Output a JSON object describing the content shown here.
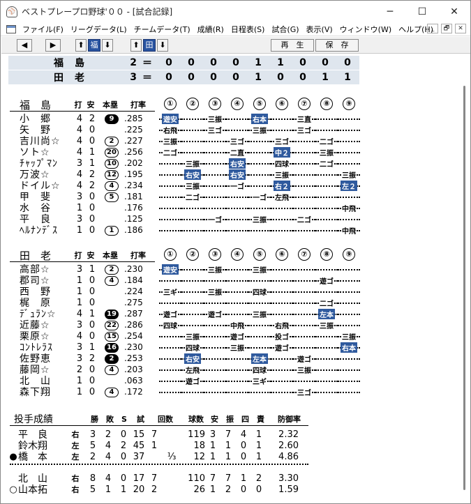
{
  "window": {
    "title": "ベストプレープロ野球'００ - [試合記録]",
    "minimize": "─",
    "maximize": "☐",
    "close": "✕"
  },
  "menu": [
    "ファイル(F)",
    "リーグデータ(L)",
    "チームデータ(T)",
    "成績(R)",
    "日程表(S)",
    "試合(G)",
    "表示(V)",
    "ウィンドウ(W)",
    "ヘルプ(H)"
  ],
  "mdi": [
    "_",
    "🗗",
    "✕"
  ],
  "toolbar": {
    "prev": "◀",
    "next": "▶",
    "up1": "⬆",
    "team_active": "福",
    "down1": "⬇",
    "up2": "⬆",
    "team2": "田",
    "down2": "⬇",
    "play": "再　生",
    "save": "保　存"
  },
  "scoreboard": [
    {
      "team": "福島",
      "total": "2",
      "eq": "＝",
      "innings": [
        "0",
        "0",
        "0",
        "0",
        "1",
        "1",
        "0",
        "0",
        "0"
      ]
    },
    {
      "team": "田老",
      "total": "3",
      "eq": "＝",
      "innings": [
        "0",
        "0",
        "0",
        "0",
        "1",
        "0",
        "0",
        "1",
        "1"
      ]
    }
  ],
  "batting_headers": {
    "ab": "打",
    "h": "安",
    "hr": "本塁",
    "avg": "打率"
  },
  "innings_labels": [
    "①",
    "②",
    "③",
    "④",
    "⑤",
    "⑥",
    "⑦",
    "⑧",
    "⑨"
  ],
  "team1": {
    "name": "福　島",
    "players": [
      {
        "name": "小　郷",
        "ab": "4",
        "h": "2",
        "hr": "9",
        "hr_filled": true,
        "avg": ".285",
        "res": [
          [
            "遊安",
            1
          ],
          [
            "",
            0
          ],
          [
            "三振",
            0
          ],
          [
            "",
            0
          ],
          [
            "右本",
            1
          ],
          [
            "",
            0
          ],
          [
            "三直",
            0
          ],
          [
            "",
            0
          ],
          [
            "",
            0
          ]
        ]
      },
      {
        "name": "矢　野",
        "ab": "4",
        "h": "0",
        "hr": "",
        "avg": ".225",
        "res": [
          [
            "右飛",
            0
          ],
          [
            "",
            0
          ],
          [
            "三ゴ",
            0
          ],
          [
            "",
            0
          ],
          [
            "三振",
            0
          ],
          [
            "",
            0
          ],
          [
            "三ゴ",
            0
          ],
          [
            "",
            0
          ],
          [
            "",
            0
          ]
        ]
      },
      {
        "name": "吉川尚☆",
        "ab": "4",
        "h": "0",
        "hr": "2",
        "avg": ".227",
        "res": [
          [
            "三振",
            0
          ],
          [
            "",
            0
          ],
          [
            "",
            0
          ],
          [
            "三ゴ",
            0
          ],
          [
            "",
            0
          ],
          [
            "三ゴ",
            0
          ],
          [
            "",
            0
          ],
          [
            "二ゴ",
            0
          ],
          [
            "",
            0
          ]
        ]
      },
      {
        "name": "ソト☆",
        "ab": "4",
        "h": "1",
        "hr": "20",
        "avg": ".256",
        "res": [
          [
            "二ゴ",
            0
          ],
          [
            "",
            0
          ],
          [
            "",
            0
          ],
          [
            "二直",
            0
          ],
          [
            "",
            0
          ],
          [
            "中２",
            1
          ],
          [
            "",
            0
          ],
          [
            "三振",
            0
          ],
          [
            "",
            0
          ]
        ]
      },
      {
        "name": "ﾁｬｯﾌﾟﾏﾝ",
        "ab": "3",
        "h": "1",
        "hr": "10",
        "avg": ".202",
        "res": [
          [
            "",
            0
          ],
          [
            "三振",
            0
          ],
          [
            "",
            0
          ],
          [
            "右安",
            1
          ],
          [
            "",
            0
          ],
          [
            "四球",
            0
          ],
          [
            "",
            0
          ],
          [
            "二ゴ",
            0
          ],
          [
            "",
            0
          ]
        ]
      },
      {
        "name": "万波☆",
        "ab": "4",
        "h": "2",
        "hr": "12",
        "avg": ".195",
        "res": [
          [
            "",
            0
          ],
          [
            "右安",
            1
          ],
          [
            "",
            0
          ],
          [
            "右安",
            1
          ],
          [
            "",
            0
          ],
          [
            "三振",
            0
          ],
          [
            "",
            0
          ],
          [
            "",
            0
          ],
          [
            "三振",
            0
          ]
        ]
      },
      {
        "name": "ドイル☆",
        "ab": "4",
        "h": "2",
        "hr": "4",
        "avg": ".234",
        "res": [
          [
            "",
            0
          ],
          [
            "三振",
            0
          ],
          [
            "",
            0
          ],
          [
            "一ゴ",
            0
          ],
          [
            "",
            0
          ],
          [
            "右２",
            1
          ],
          [
            "",
            0
          ],
          [
            "",
            0
          ],
          [
            "左２",
            1
          ]
        ]
      },
      {
        "name": "甲　斐",
        "ab": "3",
        "h": "0",
        "hr": "5",
        "avg": ".181",
        "res": [
          [
            "",
            0
          ],
          [
            "二ゴ",
            0
          ],
          [
            "",
            0
          ],
          [
            "",
            0
          ],
          [
            "一ゴ",
            0
          ],
          [
            "左飛",
            0
          ],
          [
            "",
            0
          ],
          [
            "",
            0
          ],
          [
            "",
            0
          ]
        ]
      },
      {
        "name": "水　谷",
        "ab": "1",
        "h": "0",
        "hr": "",
        "avg": ".176",
        "res": [
          [
            "",
            0
          ],
          [
            "",
            0
          ],
          [
            "",
            0
          ],
          [
            "",
            0
          ],
          [
            "",
            0
          ],
          [
            "",
            0
          ],
          [
            "",
            0
          ],
          [
            "",
            0
          ],
          [
            "中飛",
            0
          ]
        ]
      },
      {
        "name": "平　良",
        "ab": "3",
        "h": "0",
        "hr": "",
        "avg": ".125",
        "res": [
          [
            "",
            0
          ],
          [
            "",
            0
          ],
          [
            "一ゴ",
            0
          ],
          [
            "",
            0
          ],
          [
            "三振",
            0
          ],
          [
            "",
            0
          ],
          [
            "二ゴ",
            0
          ],
          [
            "",
            0
          ],
          [
            "",
            0
          ]
        ]
      },
      {
        "name": "ﾍﾙﾅﾝﾃﾞｽ",
        "ab": "1",
        "h": "0",
        "hr": "1",
        "avg": ".186",
        "res": [
          [
            "",
            0
          ],
          [
            "",
            0
          ],
          [
            "",
            0
          ],
          [
            "",
            0
          ],
          [
            "",
            0
          ],
          [
            "",
            0
          ],
          [
            "",
            0
          ],
          [
            "",
            0
          ],
          [
            "中飛",
            0
          ]
        ]
      }
    ]
  },
  "team2": {
    "name": "田　老",
    "players": [
      {
        "name": "高部☆",
        "ab": "3",
        "h": "1",
        "hr": "2",
        "avg": ".230",
        "res": [
          [
            "遊安",
            1
          ],
          [
            "",
            0
          ],
          [
            "三振",
            0
          ],
          [
            "",
            0
          ],
          [
            "三振",
            0
          ],
          [
            "",
            0
          ],
          [
            "",
            0
          ],
          [
            "",
            0
          ],
          [
            "",
            0
          ]
        ]
      },
      {
        "name": "郡司☆",
        "ab": "1",
        "h": "0",
        "hr": "4",
        "avg": ".184",
        "res": [
          [
            "",
            0
          ],
          [
            "",
            0
          ],
          [
            "",
            0
          ],
          [
            "",
            0
          ],
          [
            "",
            0
          ],
          [
            "",
            0
          ],
          [
            "",
            0
          ],
          [
            "遊ゴ",
            0
          ],
          [
            "",
            0
          ]
        ]
      },
      {
        "name": "西　野",
        "ab": "1",
        "h": "0",
        "hr": "",
        "avg": ".224",
        "res": [
          [
            "三ギ",
            0
          ],
          [
            "",
            0
          ],
          [
            "三振",
            0
          ],
          [
            "",
            0
          ],
          [
            "四球",
            0
          ],
          [
            "",
            0
          ],
          [
            "",
            0
          ],
          [
            "",
            0
          ],
          [
            "",
            0
          ]
        ]
      },
      {
        "name": "梶　原",
        "ab": "1",
        "h": "0",
        "hr": "",
        "avg": ".275",
        "res": [
          [
            "",
            0
          ],
          [
            "",
            0
          ],
          [
            "",
            0
          ],
          [
            "",
            0
          ],
          [
            "",
            0
          ],
          [
            "",
            0
          ],
          [
            "",
            0
          ],
          [
            "二ゴ",
            0
          ],
          [
            "",
            0
          ]
        ]
      },
      {
        "name": "ﾃﾞｭﾗﾝ☆",
        "ab": "4",
        "h": "1",
        "hr": "19",
        "hr_filled": true,
        "avg": ".287",
        "res": [
          [
            "遊ゴ",
            0
          ],
          [
            "",
            0
          ],
          [
            "遊ゴ",
            0
          ],
          [
            "",
            0
          ],
          [
            "三振",
            0
          ],
          [
            "",
            0
          ],
          [
            "",
            0
          ],
          [
            "左本",
            1
          ],
          [
            "",
            0
          ]
        ]
      },
      {
        "name": "近藤☆",
        "ab": "3",
        "h": "0",
        "hr": "22",
        "avg": ".286",
        "res": [
          [
            "四球",
            0
          ],
          [
            "",
            0
          ],
          [
            "",
            0
          ],
          [
            "中飛",
            0
          ],
          [
            "",
            0
          ],
          [
            "右飛",
            0
          ],
          [
            "",
            0
          ],
          [
            "三振",
            0
          ],
          [
            "",
            0
          ]
        ]
      },
      {
        "name": "栗原☆",
        "ab": "4",
        "h": "0",
        "hr": "15",
        "avg": ".254",
        "res": [
          [
            "",
            0
          ],
          [
            "三振",
            0
          ],
          [
            "",
            0
          ],
          [
            "遊ゴ",
            0
          ],
          [
            "",
            0
          ],
          [
            "投ゴ",
            0
          ],
          [
            "",
            0
          ],
          [
            "",
            0
          ],
          [
            "三振",
            0
          ]
        ]
      },
      {
        "name": "ｺﾝﾄﾚﾗｽ",
        "ab": "3",
        "h": "1",
        "hr": "16",
        "hr_filled": true,
        "avg": ".230",
        "res": [
          [
            "",
            0
          ],
          [
            "四球",
            0
          ],
          [
            "",
            0
          ],
          [
            "三振",
            0
          ],
          [
            "",
            0
          ],
          [
            "遊ゴ",
            0
          ],
          [
            "",
            0
          ],
          [
            "",
            0
          ],
          [
            "右本",
            1
          ]
        ]
      },
      {
        "name": "佐野恵",
        "ab": "3",
        "h": "2",
        "hr": "2",
        "hr_filled": true,
        "avg": ".253",
        "res": [
          [
            "",
            0
          ],
          [
            "右安",
            1
          ],
          [
            "",
            0
          ],
          [
            "",
            0
          ],
          [
            "左本",
            1
          ],
          [
            "",
            0
          ],
          [
            "遊ゴ",
            0
          ],
          [
            "",
            0
          ],
          [
            "",
            0
          ]
        ]
      },
      {
        "name": "藤岡☆",
        "ab": "2",
        "h": "0",
        "hr": "4",
        "avg": ".203",
        "res": [
          [
            "",
            0
          ],
          [
            "左飛",
            0
          ],
          [
            "",
            0
          ],
          [
            "",
            0
          ],
          [
            "四球",
            0
          ],
          [
            "",
            0
          ],
          [
            "三振",
            0
          ],
          [
            "",
            0
          ],
          [
            "",
            0
          ]
        ]
      },
      {
        "name": "北　山",
        "ab": "1",
        "h": "0",
        "hr": "",
        "avg": ".063",
        "res": [
          [
            "",
            0
          ],
          [
            "遊ゴ",
            0
          ],
          [
            "",
            0
          ],
          [
            "",
            0
          ],
          [
            "三ギ",
            0
          ],
          [
            "",
            0
          ],
          [
            "",
            0
          ],
          [
            "",
            0
          ],
          [
            "",
            0
          ]
        ]
      },
      {
        "name": "森下翔",
        "ab": "1",
        "h": "0",
        "hr": "4",
        "avg": ".172",
        "res": [
          [
            "",
            0
          ],
          [
            "",
            0
          ],
          [
            "",
            0
          ],
          [
            "",
            0
          ],
          [
            "",
            0
          ],
          [
            "",
            0
          ],
          [
            "三ゴ",
            0
          ],
          [
            "",
            0
          ],
          [
            "",
            0
          ]
        ]
      }
    ]
  },
  "pitching": {
    "title": "投手成績",
    "headers": [
      "勝",
      "敗",
      "S",
      "試",
      "回数",
      "球数",
      "安",
      "振",
      "四",
      "責",
      "防御率"
    ],
    "rows": [
      {
        "mark": "",
        "name": "平　良",
        "hand": "右",
        "w": "3",
        "l": "2",
        "s": "0",
        "g": "15",
        "ip": "7",
        "frac": "",
        "np": "119",
        "h": "3",
        "k": "7",
        "bb": "4",
        "er": "1",
        "era": "2.32"
      },
      {
        "mark": "",
        "name": "鈴木翔",
        "hand": "左",
        "w": "5",
        "l": "4",
        "s": "2",
        "g": "45",
        "ip": "1",
        "frac": "",
        "np": "18",
        "h": "1",
        "k": "1",
        "bb": "0",
        "er": "1",
        "era": "2.60"
      },
      {
        "mark": "●",
        "name": "橋　本",
        "hand": "左",
        "w": "2",
        "l": "4",
        "s": "0",
        "g": "37",
        "ip": "",
        "frac": "⅓",
        "np": "12",
        "h": "1",
        "k": "1",
        "bb": "0",
        "er": "1",
        "era": "4.86"
      },
      {
        "mark": "",
        "name": "北　山",
        "hand": "右",
        "w": "8",
        "l": "4",
        "s": "0",
        "g": "17",
        "ip": "7",
        "frac": "",
        "np": "110",
        "h": "7",
        "k": "7",
        "bb": "1",
        "er": "2",
        "era": "3.30"
      },
      {
        "mark": "○",
        "name": "山本拓",
        "hand": "右",
        "w": "5",
        "l": "1",
        "s": "1",
        "g": "20",
        "ip": "2",
        "frac": "",
        "np": "26",
        "h": "1",
        "k": "2",
        "bb": "0",
        "er": "0",
        "era": "1.59"
      }
    ]
  }
}
